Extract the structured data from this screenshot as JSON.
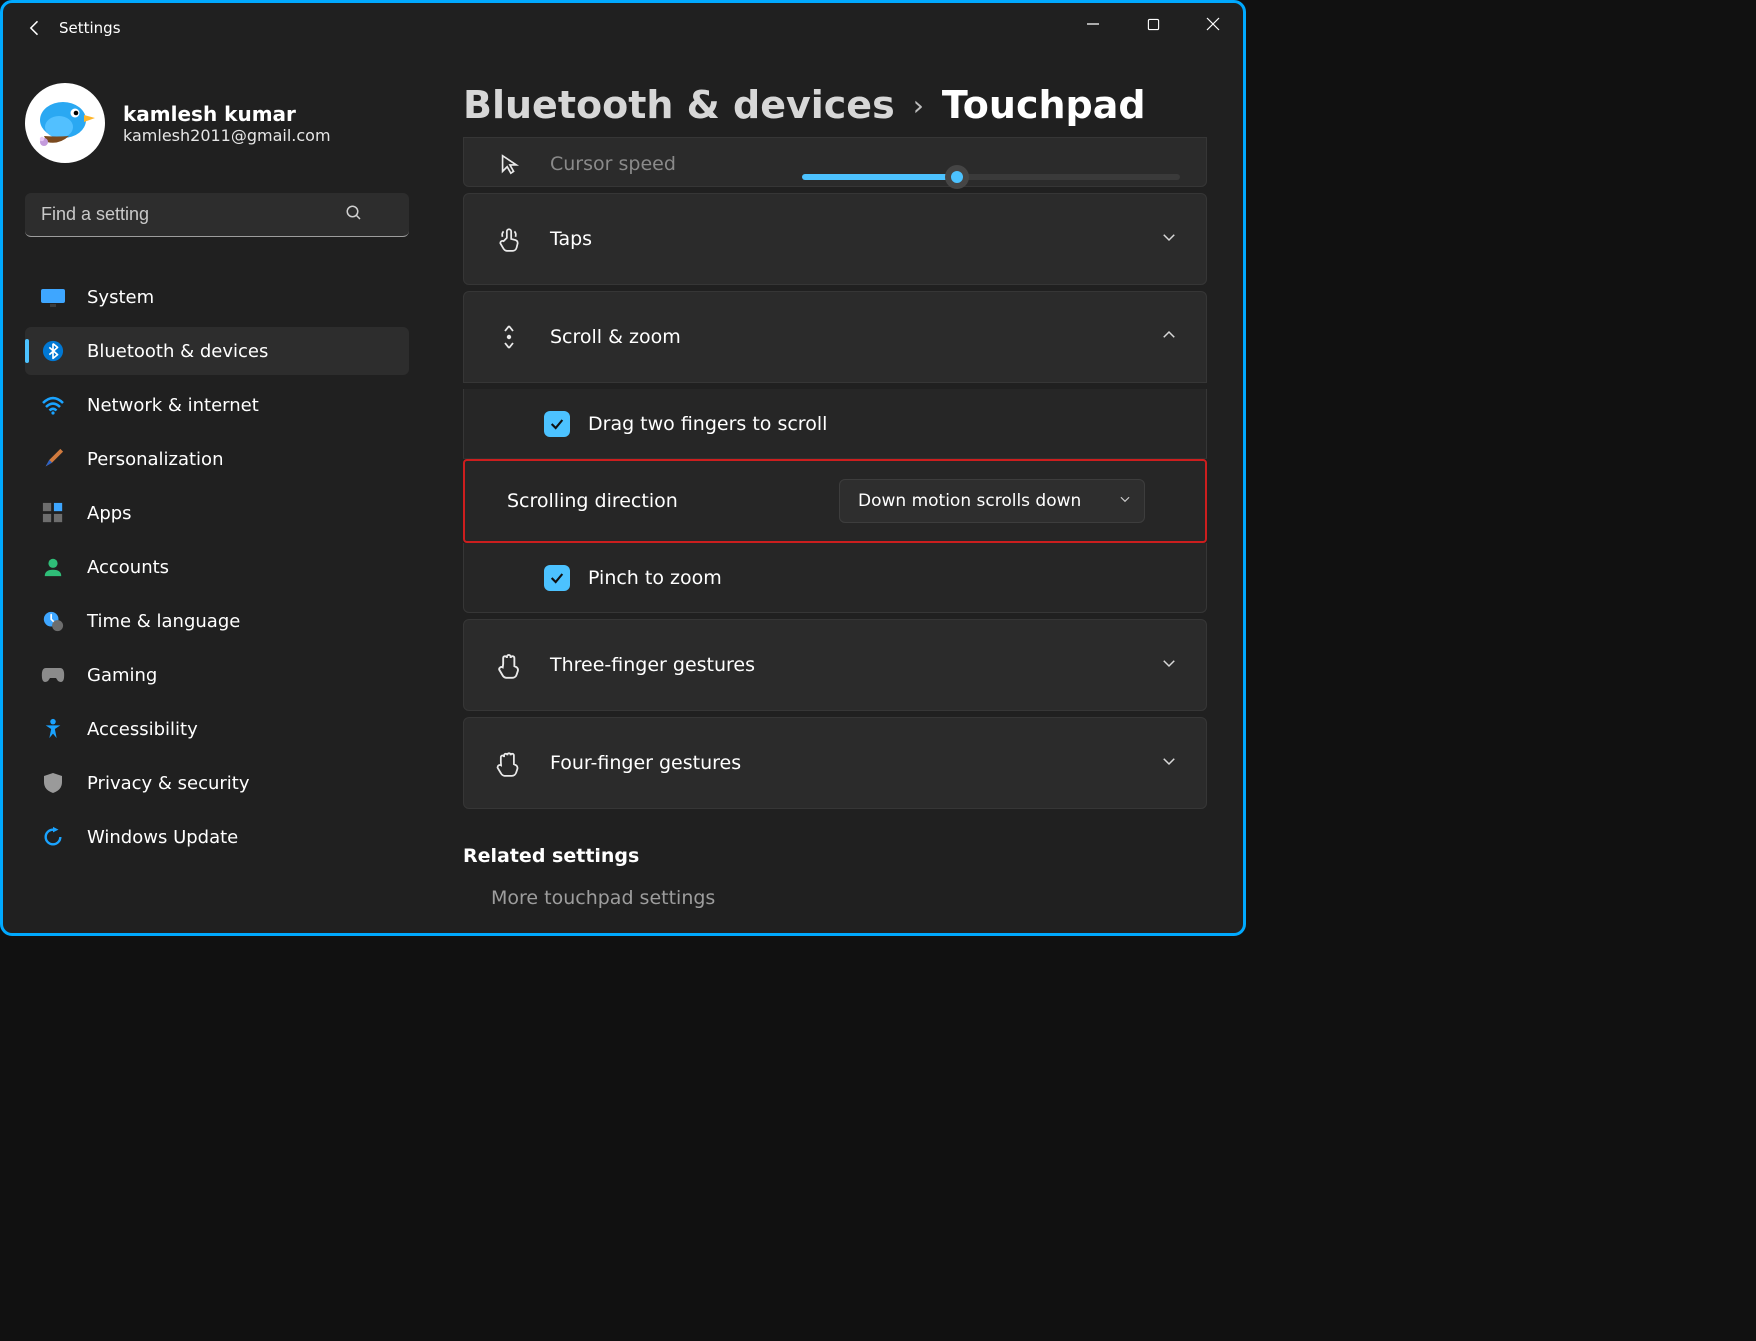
{
  "window": {
    "app_title": "Settings"
  },
  "profile": {
    "name": "kamlesh kumar",
    "email": "kamlesh2011@gmail.com"
  },
  "search": {
    "placeholder": "Find a setting"
  },
  "sidebar": {
    "items": [
      {
        "label": "System"
      },
      {
        "label": "Bluetooth & devices"
      },
      {
        "label": "Network & internet"
      },
      {
        "label": "Personalization"
      },
      {
        "label": "Apps"
      },
      {
        "label": "Accounts"
      },
      {
        "label": "Time & language"
      },
      {
        "label": "Gaming"
      },
      {
        "label": "Accessibility"
      },
      {
        "label": "Privacy & security"
      },
      {
        "label": "Windows Update"
      }
    ],
    "active_index": 1
  },
  "breadcrumb": {
    "parent": "Bluetooth & devices",
    "current": "Touchpad"
  },
  "panels": {
    "cursor_speed": {
      "label": "Cursor speed"
    },
    "taps": {
      "label": "Taps"
    },
    "scroll_zoom": {
      "label": "Scroll & zoom",
      "drag_two_fingers": "Drag two fingers to scroll",
      "scrolling_direction_label": "Scrolling direction",
      "scrolling_direction_value": "Down motion scrolls down",
      "pinch_to_zoom": "Pinch to zoom"
    },
    "three_finger": {
      "label": "Three-finger gestures"
    },
    "four_finger": {
      "label": "Four-finger gestures"
    }
  },
  "related": {
    "heading": "Related settings",
    "more_touchpad": "More touchpad settings"
  }
}
